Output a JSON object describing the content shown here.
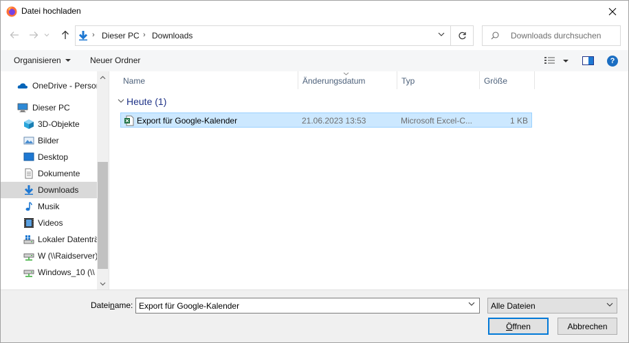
{
  "window": {
    "title": "Datei hochladen",
    "close_glyph": "✕"
  },
  "address": {
    "segments": [
      "Dieser PC",
      "Downloads"
    ],
    "separator": "›"
  },
  "search": {
    "placeholder": "Downloads durchsuchen"
  },
  "toolbar": {
    "organize_label": "Organisieren",
    "new_folder_label": "Neuer Ordner",
    "help_label": "?"
  },
  "nav": {
    "items": [
      {
        "label": "OneDrive - Person",
        "icon": "onedrive-cloud-icon"
      },
      {
        "label": "Dieser PC",
        "icon": "computer-icon"
      },
      {
        "label": "3D-Objekte",
        "icon": "3d-objects-icon"
      },
      {
        "label": "Bilder",
        "icon": "pictures-icon"
      },
      {
        "label": "Desktop",
        "icon": "desktop-icon"
      },
      {
        "label": "Dokumente",
        "icon": "documents-icon"
      },
      {
        "label": "Downloads",
        "icon": "downloads-icon",
        "selected": true
      },
      {
        "label": "Musik",
        "icon": "music-icon"
      },
      {
        "label": "Videos",
        "icon": "videos-icon"
      },
      {
        "label": "Lokaler Datenträger",
        "icon": "drive-icon"
      },
      {
        "label": "W (\\\\Raidserver)",
        "icon": "network-drive-icon"
      },
      {
        "label": "Windows_10 (\\\\",
        "icon": "network-drive-icon"
      }
    ]
  },
  "columns": {
    "name": "Name",
    "modified": "Änderungsdatum",
    "type": "Typ",
    "size": "Größe"
  },
  "group": {
    "label": "Heute (1)"
  },
  "files": [
    {
      "name": "Export für Google-Kalender",
      "modified": "21.06.2023 13:53",
      "type": "Microsoft Excel-C...",
      "size": "1 KB",
      "icon": "excel-csv-icon"
    }
  ],
  "footer": {
    "filename_label_pre": "Datei",
    "filename_label_underlined": "n",
    "filename_label_post": "ame:",
    "filename_value": "Export für Google-Kalender",
    "filetype_value": "Alle Dateien",
    "open_label_underlined": "Ö",
    "open_label_rest": "ffnen",
    "cancel_label": "Abbrechen"
  },
  "colors": {
    "accent": "#0078d7",
    "selection": "#cce8ff",
    "group_header": "#1e3287",
    "column_header": "#4c607a"
  }
}
